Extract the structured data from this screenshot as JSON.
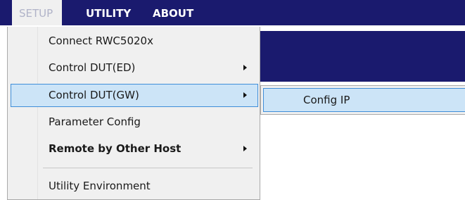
{
  "menubar": {
    "items": [
      {
        "label": "SETUP"
      },
      {
        "label": "UTILITY"
      },
      {
        "label": "ABOUT"
      }
    ]
  },
  "setup_menu": {
    "items": [
      {
        "label": "Connect RWC5020x"
      },
      {
        "label": "Control DUT(ED)"
      },
      {
        "label": "Control DUT(GW)"
      },
      {
        "label": "Parameter Config"
      },
      {
        "label": "Remote by Other Host"
      },
      {
        "label": "Utility Environment"
      }
    ]
  },
  "gw_submenu": {
    "items": [
      {
        "label": "Config IP"
      }
    ]
  },
  "colors": {
    "menubar_bg": "#1a1a6e",
    "menu_bg": "#f0f0f0",
    "highlight_bg": "#cce4f7",
    "highlight_border": "#3f8ed8"
  }
}
